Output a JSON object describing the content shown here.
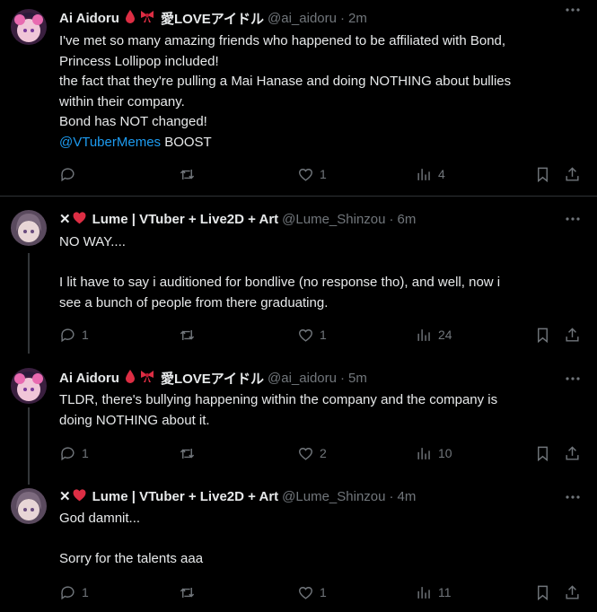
{
  "tweets": [
    {
      "name": "Ai Aidoru",
      "badges": [
        "blood-drop-icon",
        "ribbon-icon"
      ],
      "name_suffix": "愛LOVEアイドル",
      "handle": "@ai_aidoru",
      "time": "2m",
      "lines": [
        "I've met so many amazing friends who happened to be affiliated with Bond,",
        "Princess Lollipop included!",
        "the fact that they're pulling a Mai Hanase and doing NOTHING about bullies",
        "within their company.",
        "Bond has NOT changed!"
      ],
      "mention": "@VTuberMemes",
      "mention_tail": " BOOST",
      "replies": "",
      "reposts": "",
      "likes": "1",
      "views": "4"
    },
    {
      "name_prefix": "✕",
      "name": "Lume | VTuber + Live2D + Art",
      "handle": "@Lume_Shinzou",
      "time": "6m",
      "text": "NO WAY....\n\nI lit have to say i auditioned for bondlive (no response tho), and well, now i\nsee a bunch of people from there graduating.",
      "replies": "1",
      "reposts": "",
      "likes": "1",
      "views": "24"
    },
    {
      "name": "Ai Aidoru",
      "name_suffix": "愛LOVEアイドル",
      "handle": "@ai_aidoru",
      "time": "5m",
      "text": "TLDR, there's bullying happening within the company and the company is\ndoing NOTHING about it.",
      "replies": "1",
      "reposts": "",
      "likes": "2",
      "views": "10"
    },
    {
      "name_prefix": "✕",
      "name": "Lume | VTuber + Live2D + Art",
      "handle": "@Lume_Shinzou",
      "time": "4m",
      "text": "God damnit...\n\nSorry for the talents aaa",
      "replies": "1",
      "reposts": "",
      "likes": "1",
      "views": "11"
    }
  ],
  "separator": "·",
  "colors": {
    "background": "#000000",
    "text": "#e7e9ea",
    "muted": "#71767b",
    "link": "#1d9bf0",
    "heart_badge": "#f91880"
  }
}
